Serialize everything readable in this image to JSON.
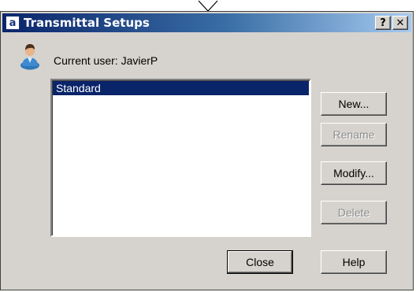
{
  "window": {
    "title": "Transmittal Setups",
    "app_icon_glyph": "a",
    "help_button": "?",
    "close_button": "✕"
  },
  "current_user": "Current user: JavierP",
  "setups_list": {
    "items": [
      "Standard"
    ],
    "selected_index": 0
  },
  "buttons": {
    "new": "New...",
    "rename": "Rename",
    "modify": "Modify...",
    "delete": "Delete",
    "close": "Close",
    "help": "Help"
  },
  "colors": {
    "title_gradient_start": "#0a246a",
    "title_gradient_end": "#a6caf0",
    "dialog_face": "#d6d3ce",
    "selection": "#0a246a"
  },
  "icons": [
    "transmittal-app-icon",
    "user-avatar-icon",
    "pointer-tip-icon"
  ]
}
